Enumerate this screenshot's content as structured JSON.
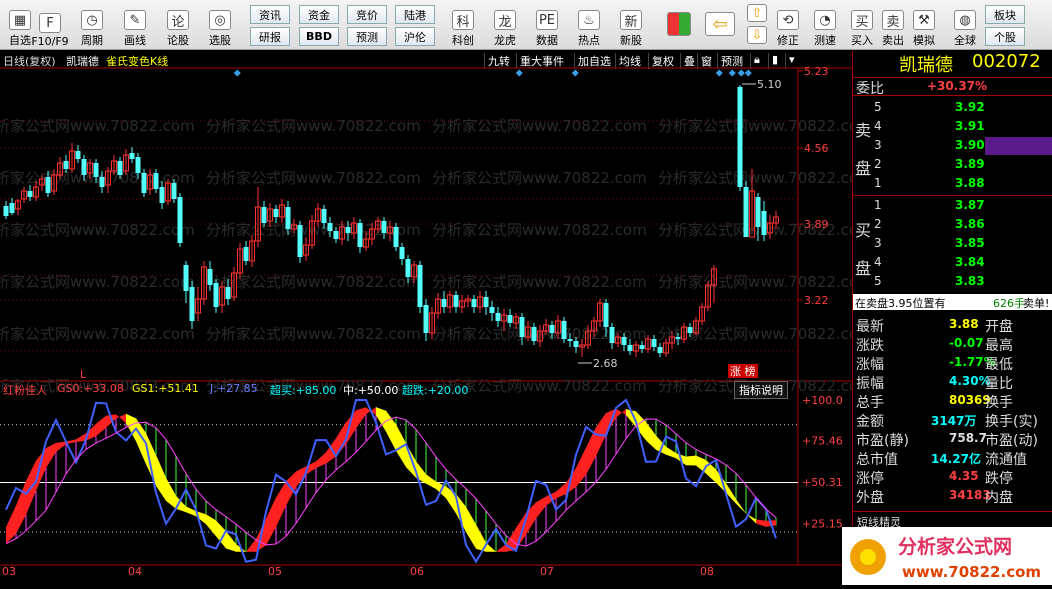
{
  "toolbar": {
    "items": [
      {
        "label": "自选",
        "icon": "table-icon"
      },
      {
        "label": "F10/F9",
        "icon": "f10-icon"
      },
      {
        "label": "周期",
        "icon": "cycle-icon"
      },
      {
        "label": "画线",
        "icon": "draw-line-icon"
      },
      {
        "label": "论股",
        "icon": "forum-icon"
      },
      {
        "label": "选股",
        "icon": "select-stock-icon"
      }
    ],
    "btn_grid": [
      [
        "资讯",
        "资金",
        "竞价",
        "陆港"
      ],
      [
        "研报",
        "BBD",
        "预测",
        "沪伦"
      ]
    ],
    "items2": [
      {
        "label": "科创",
        "icon": "kechuang-icon"
      },
      {
        "label": "龙虎",
        "icon": "dragon-tiger-icon"
      },
      {
        "label": "数据",
        "icon": "pe-data-icon"
      },
      {
        "label": "热点",
        "icon": "hot-icon"
      },
      {
        "label": "新股",
        "icon": "ipo-icon"
      }
    ],
    "items3": [
      {
        "label": "修正",
        "icon": "revise-icon"
      },
      {
        "label": "测速",
        "icon": "speed-test-icon"
      },
      {
        "label": "买入",
        "icon": "buy-icon",
        "glyph": "买"
      },
      {
        "label": "卖出",
        "icon": "sell-icon",
        "glyph": "卖"
      },
      {
        "label": "模拟",
        "icon": "simulate-icon"
      },
      {
        "label": "全球",
        "icon": "globe-icon"
      }
    ],
    "right_btns": [
      "板块",
      "个股"
    ]
  },
  "chart": {
    "period_label": "日线(复权)",
    "stock_name": "凯瑞德",
    "indicator_name": "雀氏变色K线",
    "header_buttons": [
      "九转",
      "重大事件",
      "加自选",
      "均线",
      "复权",
      "叠",
      "窗",
      "预测"
    ],
    "y_ticks": [
      "5.23",
      "4.56",
      "3.89",
      "3.22"
    ],
    "high_label": "5.10",
    "low_label": "2.68",
    "zhangbang_label": "涨 榜",
    "l_marker": "L",
    "watermark": "分析家公式网www.70822.com"
  },
  "indicator": {
    "name": "红粉佳人",
    "gs0_label": "GS0:",
    "gs0_value": "+33.08",
    "gs1_label": "GS1:",
    "gs1_value": "+51.41",
    "j_label": "J:",
    "j_value": "+27.85",
    "chaomai_label": "超买:",
    "chaomai_value": "+85.00",
    "zhong_label": "中:",
    "zhong_value": "+50.00",
    "chaodie_label": "超跌:",
    "chaodie_value": "+20.00",
    "help_btn": "指标说明",
    "y_ticks": [
      "+100.0",
      "+75.46",
      "+50.31",
      "+25.15"
    ]
  },
  "x_axis": [
    "03",
    "04",
    "05",
    "06",
    "07",
    "08"
  ],
  "panel": {
    "name": "凯瑞德",
    "code": "002072",
    "weibi_label": "委比",
    "weibi_value": "+30.37%",
    "sell_label": [
      "卖",
      "盘"
    ],
    "buy_label": [
      "买",
      "盘"
    ],
    "sell": [
      {
        "n": "5",
        "p": "3.92"
      },
      {
        "n": "4",
        "p": "3.91"
      },
      {
        "n": "3",
        "p": "3.90"
      },
      {
        "n": "2",
        "p": "3.89"
      },
      {
        "n": "1",
        "p": "3.88"
      }
    ],
    "buy": [
      {
        "n": "1",
        "p": "3.87"
      },
      {
        "n": "2",
        "p": "3.86"
      },
      {
        "n": "3",
        "p": "3.85"
      },
      {
        "n": "4",
        "p": "3.84"
      },
      {
        "n": "5",
        "p": "3.83"
      }
    ],
    "info_text": "在卖盘3.95位置有",
    "info_hands": "626手",
    "info_action": "卖单!",
    "stats": [
      {
        "l": "最新",
        "v": "3.88",
        "r": "开盘",
        "vc": "#ffff00"
      },
      {
        "l": "涨跌",
        "v": "-0.07",
        "r": "最高",
        "vc": "#00ff00"
      },
      {
        "l": "涨幅",
        "v": "-1.77%",
        "r": "最低",
        "vc": "#00ff00"
      },
      {
        "l": "振幅",
        "v": "4.30%",
        "r": "量比",
        "vc": "#00ffff"
      },
      {
        "l": "总手",
        "v": "80369",
        "r": "换手",
        "vc": "#ffff00"
      },
      {
        "l": "金额",
        "v": "3147万",
        "r": "换手(实)",
        "vc": "#00ffff"
      },
      {
        "l": "市盈(静)",
        "v": "758.7",
        "r": "市盈(动)",
        "vc": "#dddddd"
      },
      {
        "l": "总市值",
        "v": "14.27亿",
        "r": "流通值",
        "vc": "#00ffff"
      },
      {
        "l": "涨停",
        "v": "4.35",
        "r": "跌停",
        "vc": "#ff4040"
      },
      {
        "l": "外盘",
        "v": "34183",
        "r": "内盘",
        "vc": "#ff4040"
      }
    ],
    "short_title": "短线精灵"
  },
  "logo": {
    "text": "分析家公式网",
    "url": "www.70822.com"
  }
}
